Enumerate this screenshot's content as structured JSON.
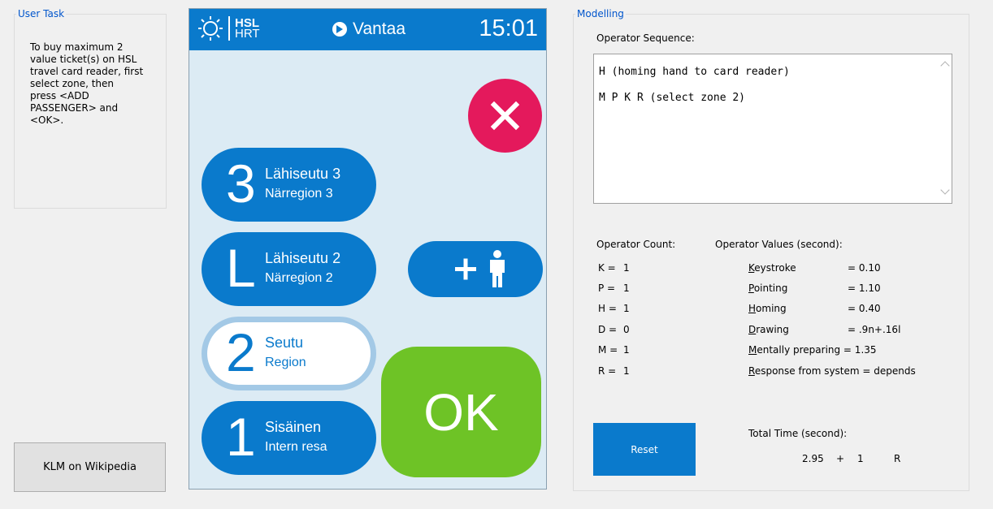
{
  "user_task": {
    "title": "User Task",
    "lines": [
      "To buy maximum 2",
      "value ticket(s) on HSL",
      "travel card reader, first",
      "select zone, then",
      "press <ADD",
      "PASSENGER> and",
      "<OK>."
    ]
  },
  "klm_button": "KLM on Wikipedia",
  "device": {
    "logo_top": "HSL",
    "logo_bottom": "HRT",
    "location": "Vantaa",
    "time": "15:01",
    "zones": [
      {
        "num": "3",
        "l1": "Lähiseutu 3",
        "l2": "Närregion 3"
      },
      {
        "num": "L",
        "l1": "Lähiseutu 2",
        "l2": "Närregion 2"
      },
      {
        "num": "2",
        "l1": "Seutu",
        "l2": "Region"
      },
      {
        "num": "1",
        "l1": "Sisäinen",
        "l2": "Intern resa"
      }
    ],
    "ok": "OK"
  },
  "modelling": {
    "title": "Modelling",
    "op_seq_label": "Operator Sequence:",
    "op_seq_lines": [
      "H (homing hand to card reader)",
      "M P K R (select zone 2)"
    ],
    "count_label": "Operator Count:",
    "counts": [
      {
        "k": "K =",
        "v": "1"
      },
      {
        "k": "P =",
        "v": "1"
      },
      {
        "k": "H =",
        "v": "1"
      },
      {
        "k": "D =",
        "v": "0"
      },
      {
        "k": "M =",
        "v": "1"
      },
      {
        "k": "R =",
        "v": "1"
      }
    ],
    "values_label": "Operator Values (second):",
    "values": [
      {
        "u": "K",
        "rest": "eystroke",
        "v": "= 0.10"
      },
      {
        "u": "P",
        "rest": "ointing",
        "v": "= 1.10"
      },
      {
        "u": "H",
        "rest": "oming",
        "v": "= 0.40"
      },
      {
        "u": "D",
        "rest": "rawing",
        "v": "= .9n+.16l"
      },
      {
        "u": "M",
        "rest": "entally preparing = 1.35",
        "v": ""
      },
      {
        "u": "R",
        "rest": "esponse from system = depends",
        "v": ""
      }
    ],
    "reset": "Reset",
    "total_label": "Total Time (second):",
    "total_a": "2.95",
    "total_plus": "+",
    "total_b": "1",
    "total_r": "R"
  },
  "colors": {
    "accent": "#0a7acc",
    "close": "#e4195c",
    "ok": "#6ec326"
  }
}
